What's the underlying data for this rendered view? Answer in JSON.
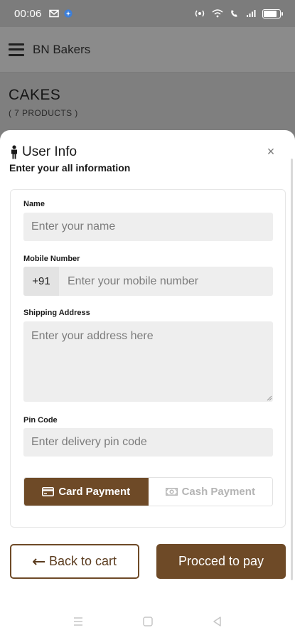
{
  "status_bar": {
    "time": "00:06",
    "left_icons": [
      "mail-icon",
      "app-badge-icon"
    ],
    "right_icons": [
      "hotspot-icon",
      "wifi-call-icon",
      "volte-icon",
      "signal-icon",
      "battery-icon"
    ],
    "battery_level": 0.85
  },
  "header": {
    "title": "BN Bakers",
    "menu_icon": "hamburger-menu-icon"
  },
  "category": {
    "title": "CAKES",
    "count": "( 7 PRODUCTS )"
  },
  "sheet": {
    "title": "User Info",
    "subtitle": "Enter your all information",
    "close_label": "×",
    "fields": {
      "name": {
        "label": "Name",
        "placeholder": "Enter your name",
        "value": ""
      },
      "mobile": {
        "label": "Mobile Number",
        "prefix": "+91",
        "placeholder": "Enter your mobile number",
        "value": ""
      },
      "address": {
        "label": "Shipping Address",
        "placeholder": "Enter your address here",
        "value": ""
      },
      "pincode": {
        "label": "Pin Code",
        "placeholder": "Enter delivery pin code",
        "value": ""
      }
    },
    "payment": {
      "options": [
        "Card Payment",
        "Cash Payment"
      ],
      "selected": "Card Payment"
    },
    "buttons": {
      "back": "Back to cart",
      "pay": "Procced to pay"
    }
  },
  "colors": {
    "brand": "#6e4a27",
    "overlay": "#7f7f7f",
    "field_bg": "#eeeeee"
  },
  "nav_bar": {
    "buttons": [
      "recents-icon",
      "home-icon",
      "back-icon"
    ]
  }
}
